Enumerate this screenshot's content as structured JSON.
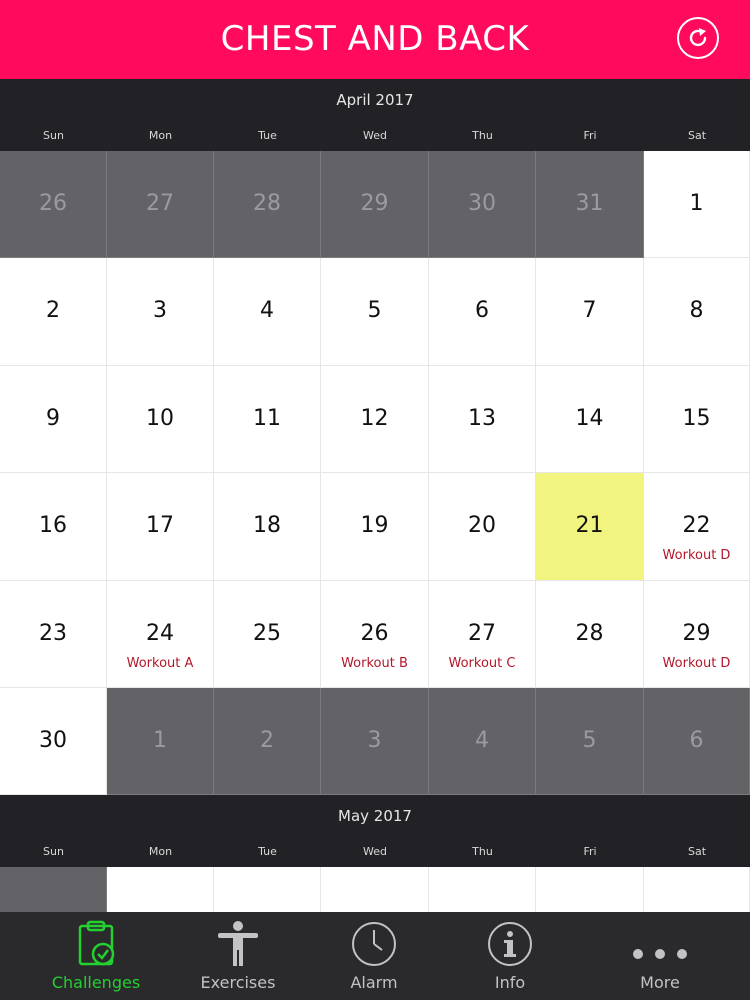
{
  "header": {
    "title": "CHEST AND BACK",
    "refresh_icon": "refresh-icon"
  },
  "april": {
    "title": "April 2017",
    "weekdays": [
      "Sun",
      "Mon",
      "Tue",
      "Wed",
      "Thu",
      "Fri",
      "Sat"
    ],
    "weeks": [
      [
        {
          "d": "26",
          "out": true
        },
        {
          "d": "27",
          "out": true
        },
        {
          "d": "28",
          "out": true
        },
        {
          "d": "29",
          "out": true
        },
        {
          "d": "30",
          "out": true
        },
        {
          "d": "31",
          "out": true
        },
        {
          "d": "1"
        }
      ],
      [
        {
          "d": "2"
        },
        {
          "d": "3"
        },
        {
          "d": "4"
        },
        {
          "d": "5"
        },
        {
          "d": "6"
        },
        {
          "d": "7"
        },
        {
          "d": "8"
        }
      ],
      [
        {
          "d": "9"
        },
        {
          "d": "10"
        },
        {
          "d": "11"
        },
        {
          "d": "12"
        },
        {
          "d": "13"
        },
        {
          "d": "14"
        },
        {
          "d": "15"
        }
      ],
      [
        {
          "d": "16"
        },
        {
          "d": "17"
        },
        {
          "d": "18"
        },
        {
          "d": "19"
        },
        {
          "d": "20"
        },
        {
          "d": "21",
          "today": true
        },
        {
          "d": "22",
          "w": "Workout D"
        }
      ],
      [
        {
          "d": "23"
        },
        {
          "d": "24",
          "w": "Workout A"
        },
        {
          "d": "25"
        },
        {
          "d": "26",
          "w": "Workout B"
        },
        {
          "d": "27",
          "w": "Workout C"
        },
        {
          "d": "28"
        },
        {
          "d": "29",
          "w": "Workout D"
        }
      ],
      [
        {
          "d": "30"
        },
        {
          "d": "1",
          "out": true
        },
        {
          "d": "2",
          "out": true
        },
        {
          "d": "3",
          "out": true
        },
        {
          "d": "4",
          "out": true
        },
        {
          "d": "5",
          "out": true
        },
        {
          "d": "6",
          "out": true
        }
      ]
    ]
  },
  "may": {
    "title": "May 2017",
    "weekdays": [
      "Sun",
      "Mon",
      "Tue",
      "Wed",
      "Thu",
      "Fri",
      "Sat"
    ],
    "partial_row": [
      {
        "d": "",
        "out": true
      },
      {
        "d": ""
      },
      {
        "d": ""
      },
      {
        "d": ""
      },
      {
        "d": ""
      },
      {
        "d": ""
      },
      {
        "d": ""
      }
    ]
  },
  "tabbar": {
    "tabs": [
      {
        "label": "Challenges",
        "icon": "clipboard-check-icon",
        "active": true
      },
      {
        "label": "Exercises",
        "icon": "person-icon"
      },
      {
        "label": "Alarm",
        "icon": "clock-icon"
      },
      {
        "label": "Info",
        "icon": "info-icon"
      },
      {
        "label": "More",
        "icon": "more-dots-icon"
      }
    ]
  },
  "colors": {
    "header": "#ff0a5c",
    "bar": "#222226",
    "out_cell": "#636367",
    "today": "#f1f57f",
    "workout_text": "#b2182b",
    "tab_active": "#23d12f"
  }
}
